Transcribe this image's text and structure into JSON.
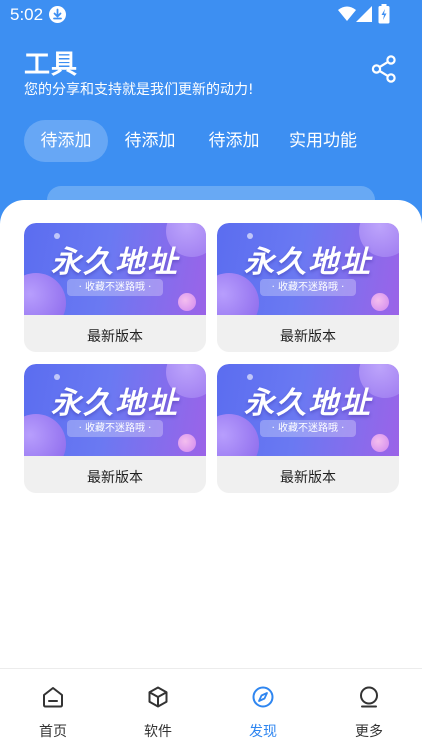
{
  "status_bar": {
    "time": "5:02"
  },
  "header": {
    "title": "工具",
    "subtitle": "您的分享和支持就是我们更新的动力!"
  },
  "tabs": [
    {
      "label": "待添加",
      "active": true
    },
    {
      "label": "待添加",
      "active": false
    },
    {
      "label": "待添加",
      "active": false
    },
    {
      "label": "实用功能",
      "active": false
    }
  ],
  "cards": [
    {
      "banner_title": "永久地址",
      "banner_tag": "· 收藏不迷路哦 ·",
      "label": "最新版本"
    },
    {
      "banner_title": "永久地址",
      "banner_tag": "· 收藏不迷路哦 ·",
      "label": "最新版本"
    },
    {
      "banner_title": "永久地址",
      "banner_tag": "· 收藏不迷路哦 ·",
      "label": "最新版本"
    },
    {
      "banner_title": "永久地址",
      "banner_tag": "· 收藏不迷路哦 ·",
      "label": "最新版本"
    }
  ],
  "bottom_nav": [
    {
      "label": "首页",
      "icon": "home-icon",
      "active": false
    },
    {
      "label": "软件",
      "icon": "cube-icon",
      "active": false
    },
    {
      "label": "发现",
      "icon": "compass-icon",
      "active": true
    },
    {
      "label": "更多",
      "icon": "more-icon",
      "active": false
    }
  ],
  "colors": {
    "header_bg": "#3d8ff2",
    "nav_active": "#2f86f0",
    "banner_gradient_start": "#5b6df0",
    "banner_gradient_end": "#9b63e8"
  }
}
